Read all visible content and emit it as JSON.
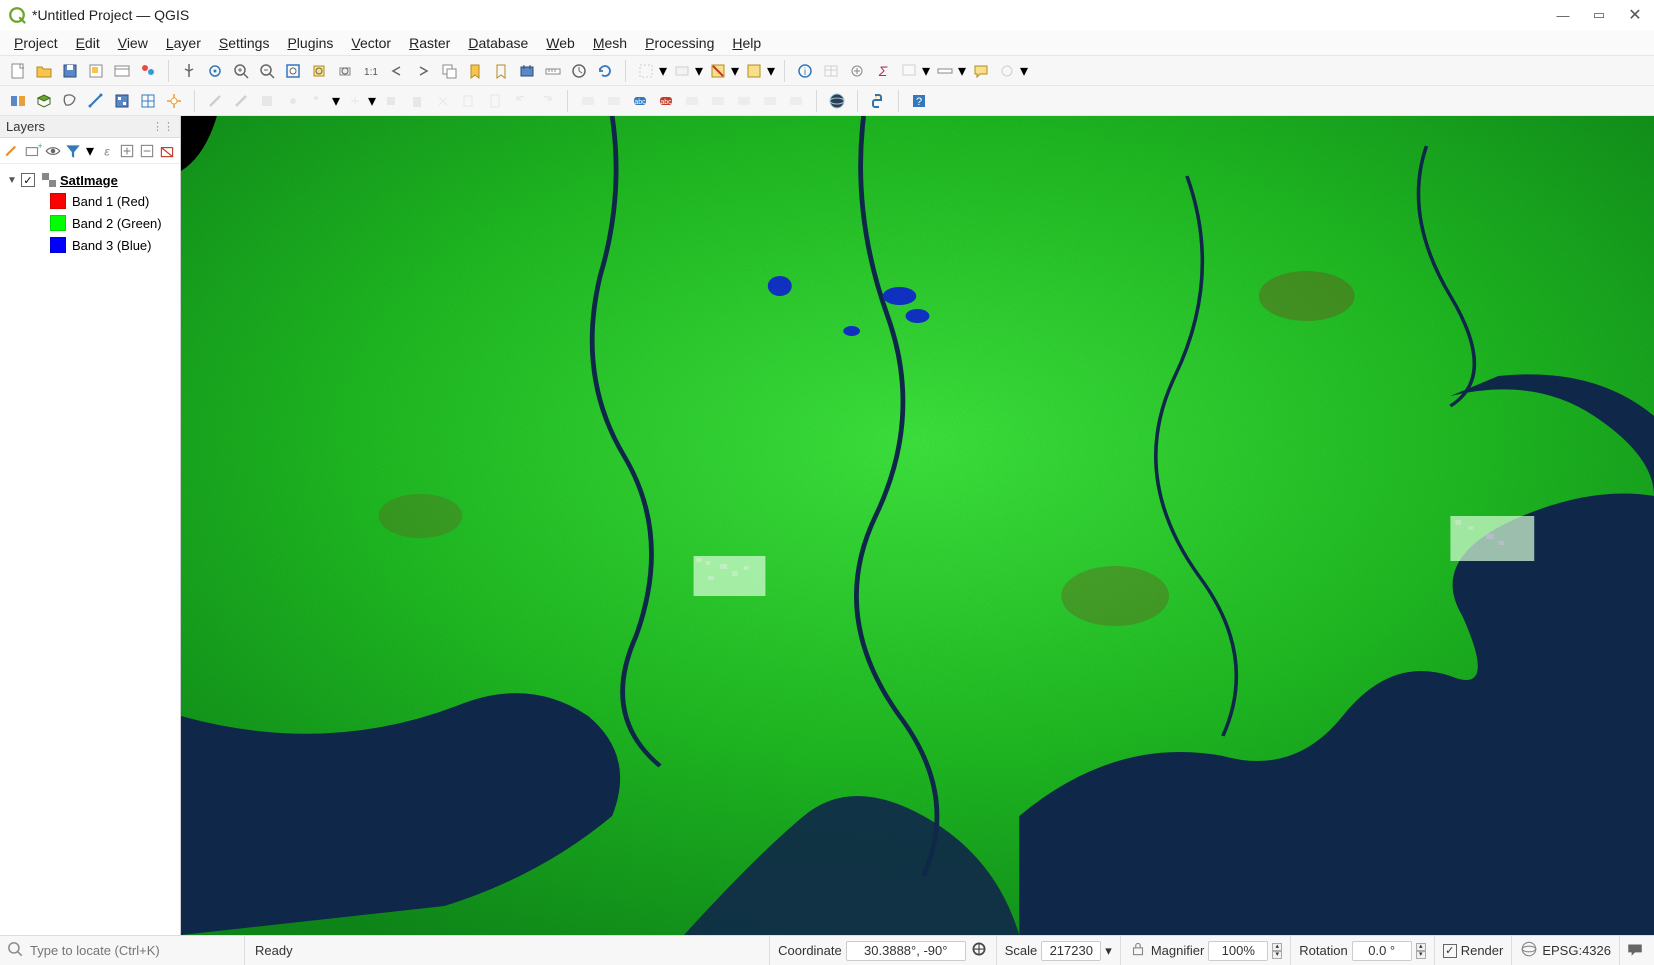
{
  "title": "*Untitled Project — QGIS",
  "menu": [
    "Project",
    "Edit",
    "View",
    "Layer",
    "Settings",
    "Plugins",
    "Vector",
    "Raster",
    "Database",
    "Web",
    "Mesh",
    "Processing",
    "Help"
  ],
  "layers": {
    "panel_title": "Layers",
    "root": {
      "name": "SatImage",
      "bands": [
        {
          "label": "Band 1 (Red)",
          "color": "#ff0000"
        },
        {
          "label": "Band 2 (Green)",
          "color": "#00ff00"
        },
        {
          "label": "Band 3 (Blue)",
          "color": "#0000ff"
        }
      ]
    }
  },
  "status": {
    "locator_placeholder": "Type to locate (Ctrl+K)",
    "ready": "Ready",
    "coordinate_label": "Coordinate",
    "coordinate_value": "30.3888°, -90°",
    "scale_label": "Scale",
    "scale_value": "217230",
    "magnifier_label": "Magnifier",
    "magnifier_value": "100%",
    "rotation_label": "Rotation",
    "rotation_value": "0.0 °",
    "render_label": "Render",
    "crs_label": "EPSG:4326"
  },
  "colors": {
    "water": "#0f2749",
    "land_light": "#20d820",
    "land_dark": "#0f7a1a"
  }
}
